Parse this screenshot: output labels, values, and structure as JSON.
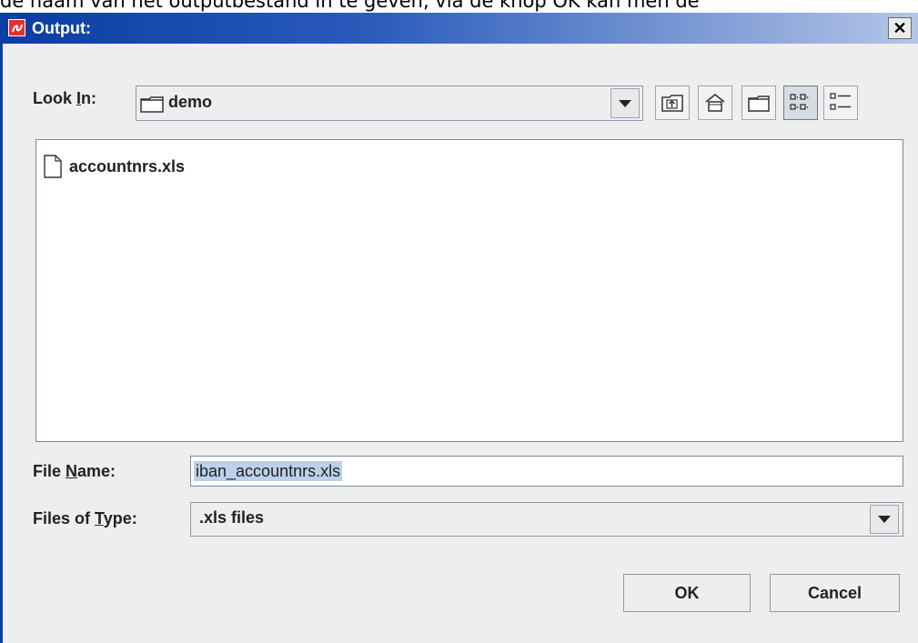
{
  "background_text": "de naam van het outputbestand in te geven, via de knop OK kan men de",
  "window": {
    "title": "Output:",
    "close_label": "✕"
  },
  "look_in": {
    "label_prefix": "Look ",
    "label_mnemonic": "I",
    "label_suffix": "n:",
    "folder": "demo"
  },
  "toolbar": [
    {
      "name": "up-one-level-icon"
    },
    {
      "name": "home-icon"
    },
    {
      "name": "new-folder-icon"
    },
    {
      "name": "list-view-icon"
    },
    {
      "name": "details-view-icon"
    }
  ],
  "files": [
    {
      "name": "accountnrs.xls",
      "icon": "file-icon"
    }
  ],
  "file_name": {
    "label_prefix": "File ",
    "label_mnemonic": "N",
    "label_suffix": "ame:",
    "value": "iban_accountnrs.xls"
  },
  "files_of_type": {
    "label_prefix": "Files of ",
    "label_mnemonic": "T",
    "label_suffix": "ype:",
    "value": ".xls files"
  },
  "buttons": {
    "ok": "OK",
    "cancel": "Cancel"
  }
}
